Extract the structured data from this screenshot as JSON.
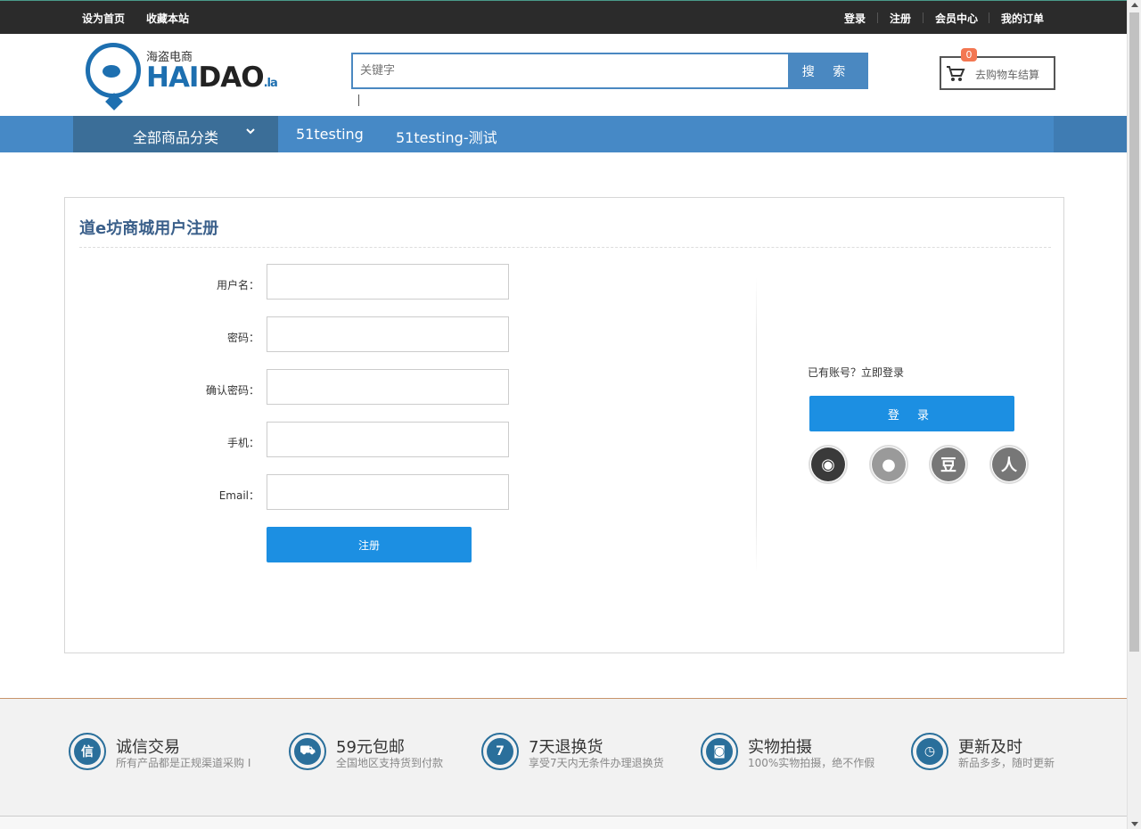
{
  "topbar": {
    "set_home": "设为首页",
    "favorite": "收藏本站",
    "login": "登录",
    "register": "注册",
    "member_center": "会员中心",
    "my_orders": "我的订单"
  },
  "logo": {
    "cn": "海盗电商",
    "en_blue": "HAI",
    "en_dark": "DAO",
    "en_suffix": ".la"
  },
  "search": {
    "placeholder": "关键字",
    "button": "搜 索"
  },
  "cart": {
    "label": "去购物车结算",
    "count": "0"
  },
  "nav": {
    "all_categories": "全部商品分类",
    "links": [
      "51testing",
      "51testing-测试"
    ]
  },
  "register": {
    "title": "道e坊商城用户注册",
    "fields": [
      {
        "label": "用户名：",
        "value": ""
      },
      {
        "label": "密码：",
        "value": ""
      },
      {
        "label": "确认密码：",
        "value": ""
      },
      {
        "label": "手机：",
        "value": ""
      },
      {
        "label": "Email：",
        "value": ""
      }
    ],
    "submit": "注册"
  },
  "login_side": {
    "have_account": "已有账号？立即登录",
    "login_button": "登 录",
    "social": [
      {
        "name": "weibo-icon",
        "glyph": "◉",
        "color": "#3a3a3a"
      },
      {
        "name": "qq-icon",
        "glyph": "●",
        "color": "#9a9a9a"
      },
      {
        "name": "douban-icon",
        "glyph": "豆",
        "color": "#777777"
      },
      {
        "name": "renren-icon",
        "glyph": "人",
        "color": "#777777"
      }
    ]
  },
  "features": [
    {
      "icon": "信",
      "title": "诚信交易",
      "sub": "所有产品都是正规渠道采购 I"
    },
    {
      "icon": "⛟",
      "title": "59元包邮",
      "sub": "全国地区支持货到付款"
    },
    {
      "icon": "7",
      "title": "7天退换货",
      "sub": "享受7天内无条件办理退换货"
    },
    {
      "icon": "◙",
      "title": "实物拍摄",
      "sub": "100%实物拍摄，绝不作假"
    },
    {
      "icon": "◷",
      "title": "更新及时",
      "sub": "新品多多，随时更新"
    }
  ]
}
